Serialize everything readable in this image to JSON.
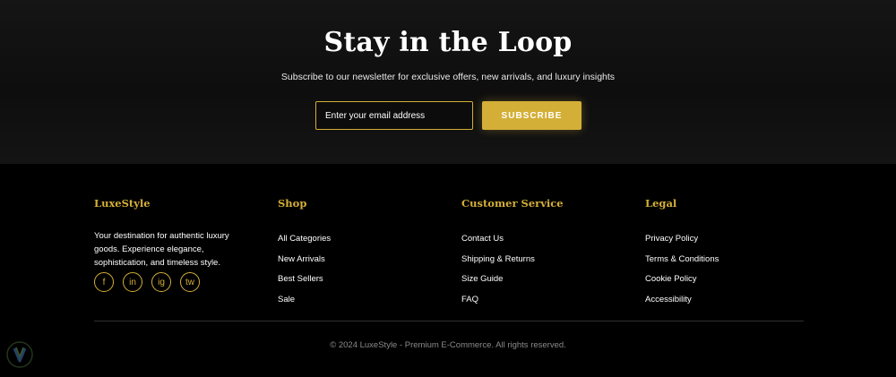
{
  "newsletter": {
    "title": "Stay in the Loop",
    "subtitle": "Subscribe to our newsletter for exclusive offers, new arrivals, and luxury insights",
    "email_placeholder": "Enter your email address",
    "subscribe_label": "SUBSCRIBE"
  },
  "footer": {
    "brand": {
      "heading": "LuxeStyle",
      "description": "Your destination for authentic luxury goods. Experience elegance, sophistication, and timeless style.",
      "socials": [
        {
          "label": "f",
          "icon": "facebook-icon"
        },
        {
          "label": "in",
          "icon": "linkedin-icon"
        },
        {
          "label": "ig",
          "icon": "instagram-icon"
        },
        {
          "label": "tw",
          "icon": "twitter-icon"
        }
      ]
    },
    "shop": {
      "heading": "Shop",
      "links": [
        "All Categories",
        "New Arrivals",
        "Best Sellers",
        "Sale"
      ]
    },
    "customer_service": {
      "heading": "Customer Service",
      "links": [
        "Contact Us",
        "Shipping & Returns",
        "Size Guide",
        "FAQ"
      ]
    },
    "legal": {
      "heading": "Legal",
      "links": [
        "Privacy Policy",
        "Terms & Conditions",
        "Cookie Policy",
        "Accessibility"
      ]
    },
    "copyright": "© 2024 LuxeStyle - Premium E-Commerce. All rights reserved."
  },
  "colors": {
    "accent": "#d4af37",
    "background": "#000000",
    "newsletter_background": "#121212",
    "text": "#ffffff",
    "muted_text": "#8a8a8a"
  }
}
